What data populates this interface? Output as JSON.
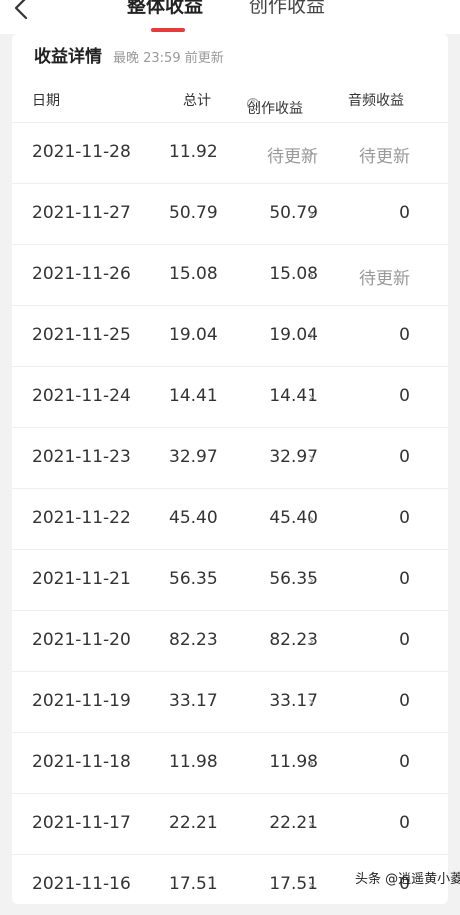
{
  "tabs": [
    {
      "label": "整体收益",
      "active": true
    },
    {
      "label": "创作收益",
      "active": false
    }
  ],
  "colors": {
    "accent": "#e63b3b",
    "muted": "#999999"
  },
  "card": {
    "title": "收益详情",
    "subtitle": "最晚 23:59 前更新"
  },
  "table": {
    "headers": [
      "日期",
      "总计",
      "创作收益",
      "音频收益"
    ],
    "rows": [
      {
        "date": "2021-11-28",
        "total": "11.92",
        "create": "待更新",
        "audio": "待更新"
      },
      {
        "date": "2021-11-27",
        "total": "50.79",
        "create": "50.79",
        "audio": "0"
      },
      {
        "date": "2021-11-26",
        "total": "15.08",
        "create": "15.08",
        "audio": "待更新"
      },
      {
        "date": "2021-11-25",
        "total": "19.04",
        "create": "19.04",
        "audio": "0"
      },
      {
        "date": "2021-11-24",
        "total": "14.41",
        "create": "14.41",
        "audio": "0"
      },
      {
        "date": "2021-11-23",
        "total": "32.97",
        "create": "32.97",
        "audio": "0"
      },
      {
        "date": "2021-11-22",
        "total": "45.40",
        "create": "45.40",
        "audio": "0"
      },
      {
        "date": "2021-11-21",
        "total": "56.35",
        "create": "56.35",
        "audio": "0"
      },
      {
        "date": "2021-11-20",
        "total": "82.23",
        "create": "82.23",
        "audio": "0"
      },
      {
        "date": "2021-11-19",
        "total": "33.17",
        "create": "33.17",
        "audio": "0"
      },
      {
        "date": "2021-11-18",
        "total": "11.98",
        "create": "11.98",
        "audio": "0"
      },
      {
        "date": "2021-11-17",
        "total": "22.21",
        "create": "22.21",
        "audio": "0"
      },
      {
        "date": "2021-11-16",
        "total": "17.51",
        "create": "17.51",
        "audio": "0"
      }
    ]
  },
  "watermark": "头条 @逍遥黄小菱"
}
